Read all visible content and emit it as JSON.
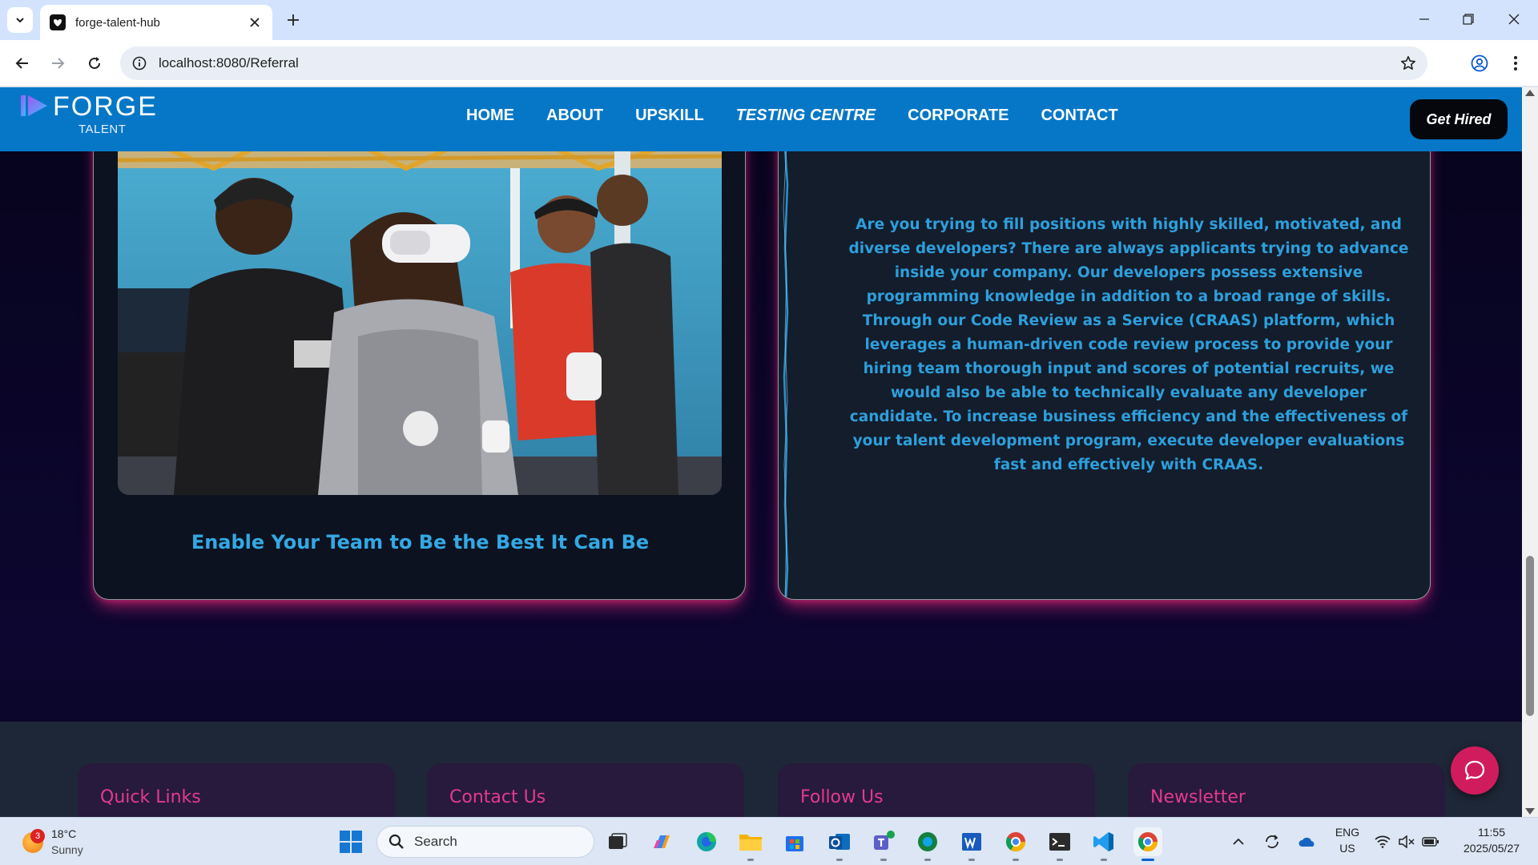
{
  "browser": {
    "tab_title": "forge-talent-hub",
    "url": "localhost:8080/Referral"
  },
  "site": {
    "logo_word": "FORGE",
    "logo_sub": "TALENT",
    "nav": [
      {
        "label": "HOME"
      },
      {
        "label": "ABOUT"
      },
      {
        "label": "UPSKILL"
      },
      {
        "label": "TESTING CENTRE"
      },
      {
        "label": "CORPORATE"
      },
      {
        "label": "CONTACT"
      }
    ],
    "cta": "Get Hired"
  },
  "cards": {
    "left_heading": "Enable Your Team to Be the Best It Can Be",
    "right_body": "Are you trying to fill positions with highly skilled, motivated, and diverse developers? There are always applicants trying to advance inside your company. Our developers possess extensive programming knowledge in addition to a broad range of skills. Through our Code Review as a Service (CRAAS) platform, which leverages a human-driven code review process to provide your hiring team thorough input and scores of potential recruits, we would also be able to technically evaluate any developer candidate. To increase business efficiency and the effectiveness of your talent development program, execute developer evaluations fast and effectively with CRAAS."
  },
  "footer": {
    "columns": [
      {
        "title": "Quick Links"
      },
      {
        "title": "Contact Us"
      },
      {
        "title": "Follow Us"
      },
      {
        "title": "Newsletter"
      }
    ]
  },
  "taskbar": {
    "weather_badge": "3",
    "temperature": "18°C",
    "condition": "Sunny",
    "search_label": "Search",
    "lang_line1": "ENG",
    "lang_line2": "US",
    "time": "11:55",
    "date": "2025/05/27"
  },
  "colors": {
    "nav_bg": "#0677c7",
    "accent_blue": "#2e9fdb",
    "footer_title": "#e43a8e",
    "chat_fab": "#d01c5d"
  }
}
